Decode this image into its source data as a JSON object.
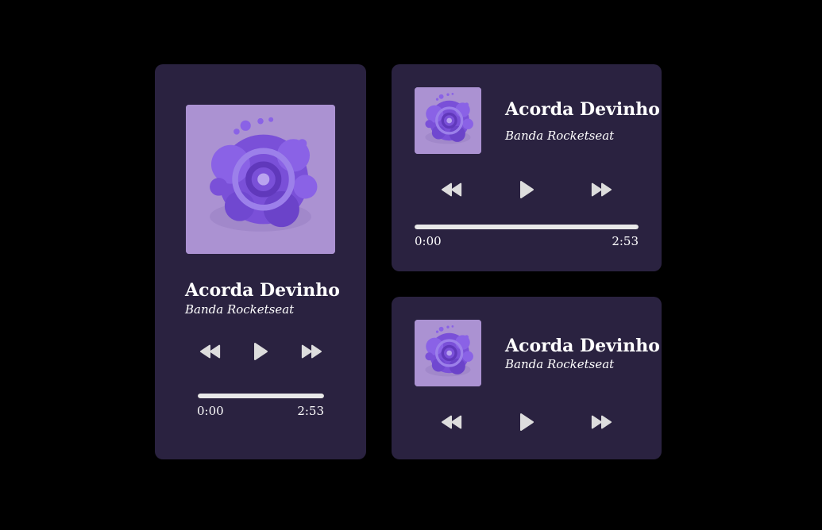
{
  "colors": {
    "page_bg": "#000000",
    "card_bg": "#2a2240",
    "art_bg": "#ab92d2",
    "blob": "#7d55d8",
    "icon": "#dddddd"
  },
  "icons": {
    "rewind": "rewind-icon",
    "play": "play-icon",
    "fast_forward": "fast-forward-icon"
  },
  "cards": {
    "large": {
      "title": "Acorda Devinho",
      "artist": "Banda Rocketseat",
      "time_start": "0:00",
      "time_end": "2:53",
      "progress": 1.0
    },
    "medium": {
      "title": "Acorda Devinho",
      "artist": "Banda Rocketseat",
      "time_start": "0:00",
      "time_end": "2:53",
      "progress": 1.0
    },
    "small": {
      "title": "Acorda Devinho",
      "artist": "Banda Rocketseat"
    }
  }
}
